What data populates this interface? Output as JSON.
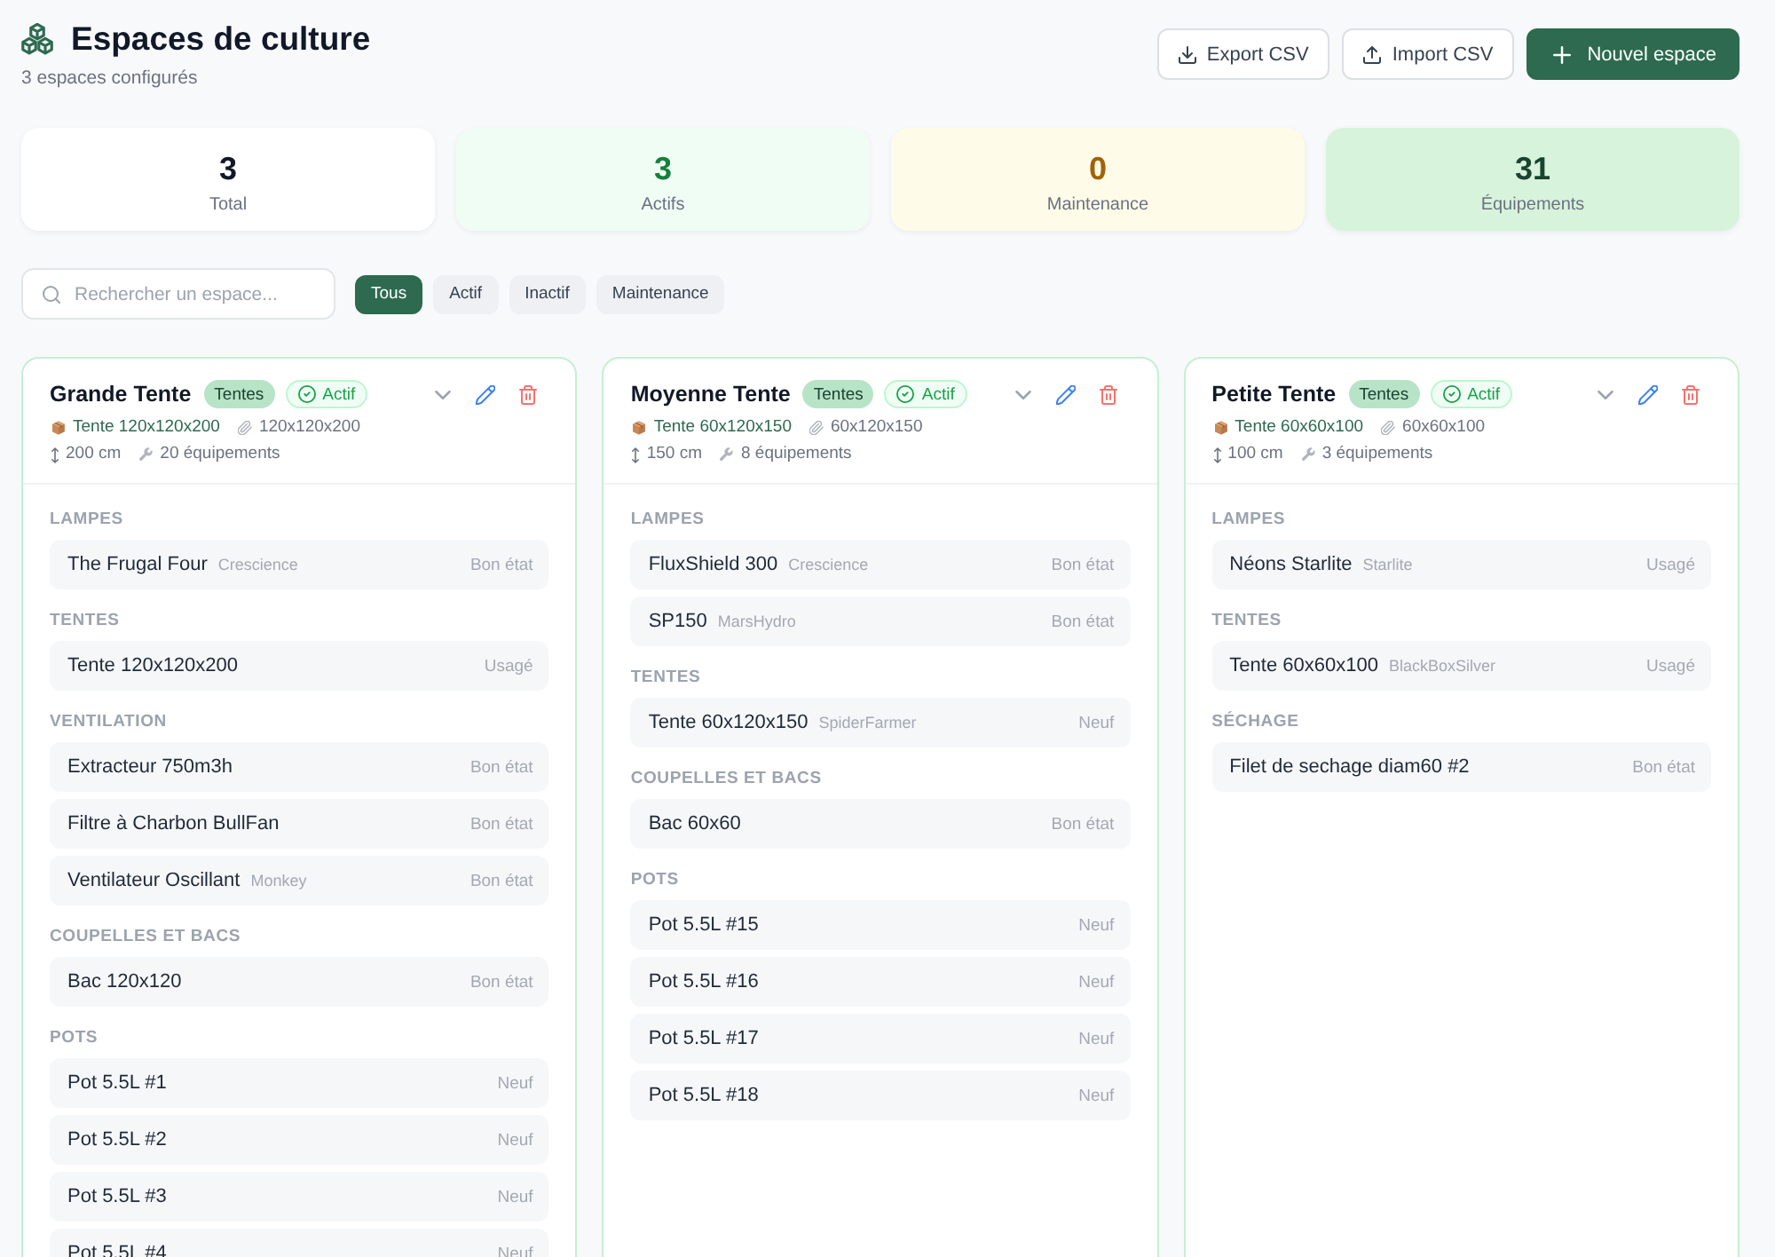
{
  "header": {
    "title": "Espaces de culture",
    "subtitle": "3 espaces configurés"
  },
  "actions": [
    {
      "label": "Export CSV",
      "kind": "export"
    },
    {
      "label": "Import CSV",
      "kind": "import"
    },
    {
      "label": "Nouvel espace",
      "kind": "create"
    }
  ],
  "stats": [
    {
      "value": "3",
      "label": "Total",
      "kind": "neutral"
    },
    {
      "value": "3",
      "label": "Actifs",
      "kind": "active"
    },
    {
      "value": "0",
      "label": "Maintenance",
      "kind": "maintenance"
    },
    {
      "value": "31",
      "label": "Équipements",
      "kind": "equipment"
    }
  ],
  "search": {
    "placeholder": "Rechercher un espace..."
  },
  "filters": [
    {
      "label": "Tous",
      "selected": true
    },
    {
      "label": "Actif",
      "selected": false
    },
    {
      "label": "Inactif",
      "selected": false
    },
    {
      "label": "Maintenance",
      "selected": false
    }
  ],
  "spaces": [
    {
      "name": "Grande Tente",
      "type": "Tentes",
      "status": "Actif",
      "active": true,
      "tent_model": "Tente 120x120x200",
      "dimensions": "120x120x200",
      "height": "200 cm",
      "equipment_count": "20 équipements",
      "categories": [
        {
          "label": "LAMPES",
          "items": [
            {
              "name": "The Frugal Four",
              "brand": "Crescience",
              "condition": "Bon état"
            }
          ]
        },
        {
          "label": "TENTES",
          "items": [
            {
              "name": "Tente 120x120x200",
              "condition": "Usagé"
            }
          ]
        },
        {
          "label": "VENTILATION",
          "items": [
            {
              "name": "Extracteur 750m3h",
              "condition": "Bon état"
            },
            {
              "name": "Filtre à Charbon BullFan",
              "condition": "Bon état"
            },
            {
              "name": "Ventilateur Oscillant",
              "brand": "Monkey",
              "condition": "Bon état"
            }
          ]
        },
        {
          "label": "COUPELLES ET BACS",
          "items": [
            {
              "name": "Bac 120x120",
              "condition": "Bon état"
            }
          ]
        },
        {
          "label": "POTS",
          "items": [
            {
              "name": "Pot 5.5L #1",
              "condition": "Neuf"
            },
            {
              "name": "Pot 5.5L #2",
              "condition": "Neuf"
            },
            {
              "name": "Pot 5.5L #3",
              "condition": "Neuf"
            },
            {
              "name": "Pot 5.5L #4",
              "condition": "Neuf"
            }
          ]
        }
      ]
    },
    {
      "name": "Moyenne Tente",
      "type": "Tentes",
      "status": "Actif",
      "active": true,
      "tent_model": "Tente 60x120x150",
      "dimensions": "60x120x150",
      "height": "150 cm",
      "equipment_count": "8 équipements",
      "categories": [
        {
          "label": "LAMPES",
          "items": [
            {
              "name": "FluxShield 300",
              "brand": "Crescience",
              "condition": "Bon état"
            },
            {
              "name": "SP150",
              "brand": "MarsHydro",
              "condition": "Bon état"
            }
          ]
        },
        {
          "label": "TENTES",
          "items": [
            {
              "name": "Tente 60x120x150",
              "brand": "SpiderFarmer",
              "condition": "Neuf"
            }
          ]
        },
        {
          "label": "COUPELLES ET BACS",
          "items": [
            {
              "name": "Bac 60x60",
              "condition": "Bon état"
            }
          ]
        },
        {
          "label": "POTS",
          "items": [
            {
              "name": "Pot 5.5L #15",
              "condition": "Neuf"
            },
            {
              "name": "Pot 5.5L #16",
              "condition": "Neuf"
            },
            {
              "name": "Pot 5.5L #17",
              "condition": "Neuf"
            },
            {
              "name": "Pot 5.5L #18",
              "condition": "Neuf"
            }
          ]
        }
      ]
    },
    {
      "name": "Petite Tente",
      "type": "Tentes",
      "status": "Actif",
      "active": true,
      "tent_model": "Tente 60x60x100",
      "dimensions": "60x60x100",
      "height": "100 cm",
      "equipment_count": "3 équipements",
      "categories": [
        {
          "label": "LAMPES",
          "items": [
            {
              "name": "Néons Starlite",
              "brand": "Starlite",
              "condition": "Usagé"
            }
          ]
        },
        {
          "label": "TENTES",
          "items": [
            {
              "name": "Tente 60x60x100",
              "brand": "BlackBoxSilver",
              "condition": "Usagé"
            }
          ]
        },
        {
          "label": "SÉCHAGE",
          "items": [
            {
              "name": "Filet de sechage diam60 #2",
              "condition": "Bon état"
            }
          ]
        }
      ]
    }
  ]
}
